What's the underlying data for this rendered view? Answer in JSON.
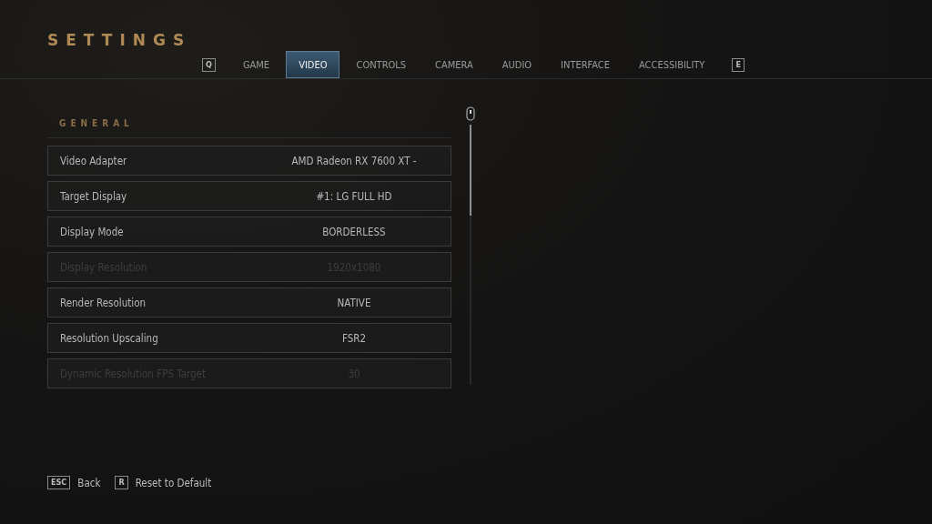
{
  "title": "SETTINGS",
  "tabs": {
    "prev_key": "Q",
    "next_key": "E",
    "items": [
      {
        "label": "GAME",
        "selected": false
      },
      {
        "label": "VIDEO",
        "selected": true
      },
      {
        "label": "CONTROLS",
        "selected": false
      },
      {
        "label": "CAMERA",
        "selected": false
      },
      {
        "label": "AUDIO",
        "selected": false
      },
      {
        "label": "INTERFACE",
        "selected": false
      },
      {
        "label": "ACCESSIBILITY",
        "selected": false
      }
    ]
  },
  "section": "GENERAL",
  "settings": [
    {
      "label": "Video Adapter",
      "value": "AMD Radeon RX 7600 XT -",
      "disabled": false
    },
    {
      "label": "Target Display",
      "value": "#1: LG FULL HD",
      "disabled": false
    },
    {
      "label": "Display Mode",
      "value": "BORDERLESS",
      "disabled": false
    },
    {
      "label": "Display Resolution",
      "value": "1920x1080",
      "disabled": true
    },
    {
      "label": "Render Resolution",
      "value": "NATIVE",
      "disabled": false
    },
    {
      "label": "Resolution Upscaling",
      "value": "FSR2",
      "disabled": false
    },
    {
      "label": "Dynamic Resolution FPS Target",
      "value": "30",
      "disabled": true
    }
  ],
  "footer": [
    {
      "key": "ESC",
      "label": "Back"
    },
    {
      "key": "R",
      "label": "Reset to Default"
    }
  ]
}
